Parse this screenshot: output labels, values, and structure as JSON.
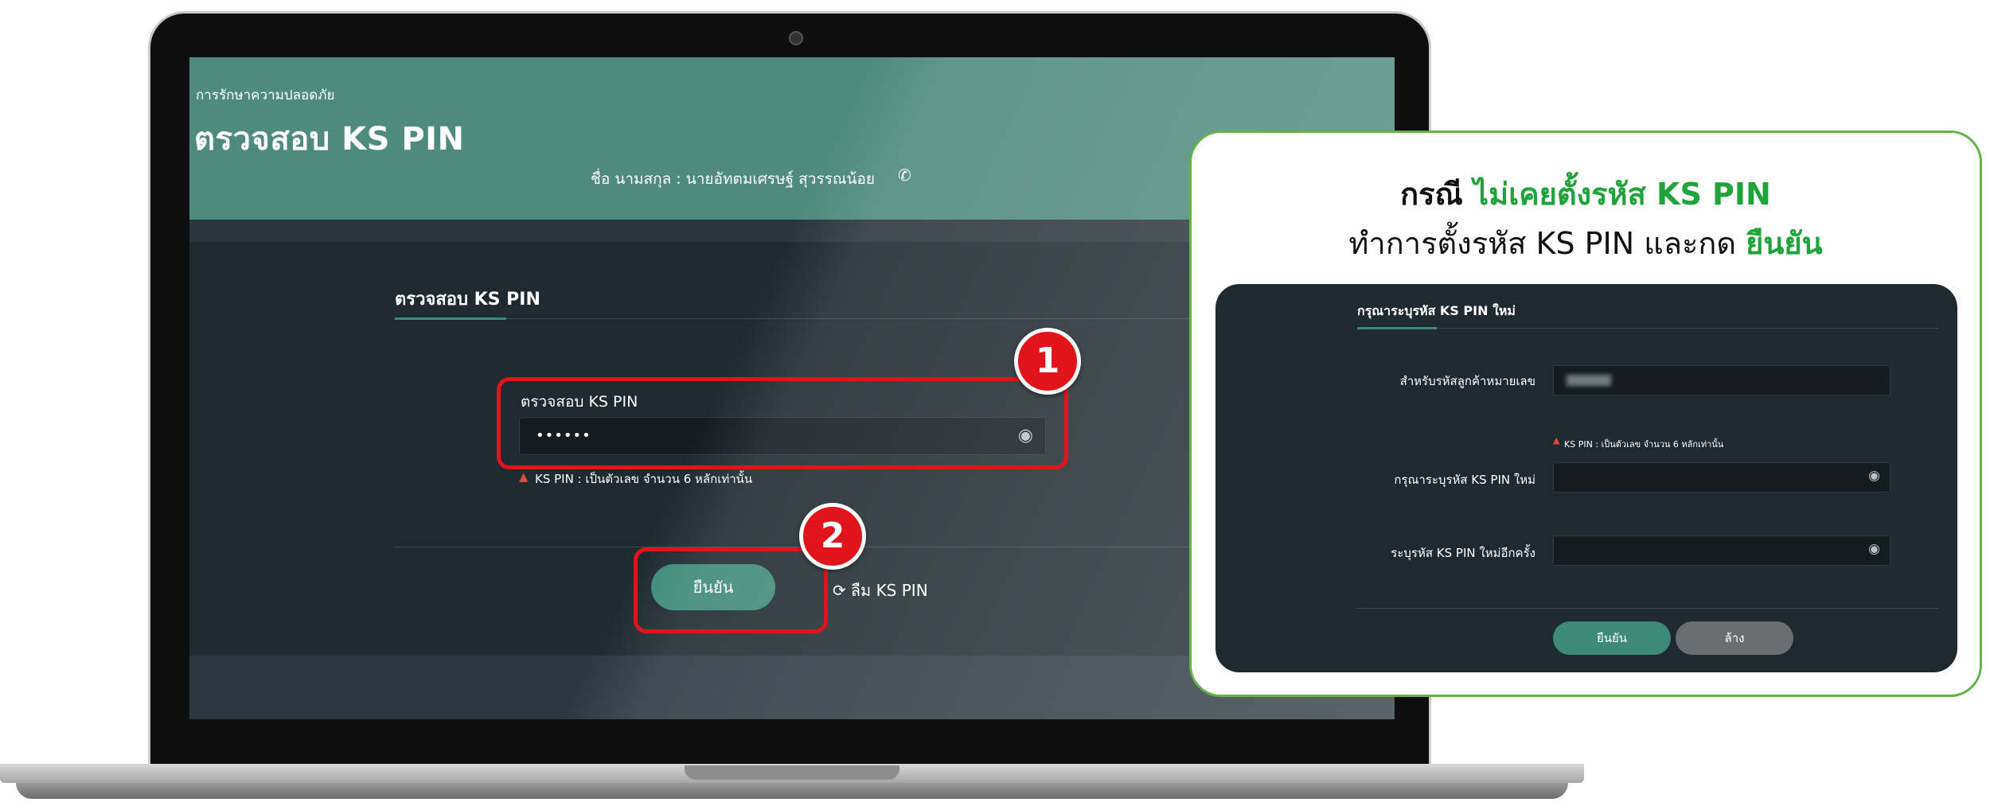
{
  "app": {
    "breadcrumb": "การรักษาความปลอดภัย",
    "page_title": "ตรวจสอบ KS PIN",
    "user_label": "ชื่อ นามสกุล :  นายอัทตมเศรษฐ์ สุวรรณน้อย"
  },
  "form": {
    "section_title": "ตรวจสอบ KS PIN",
    "field_label": "ตรวจสอบ KS PIN",
    "pin_value": "••••••",
    "hint": "KS PIN : เป็นตัวเลข จำนวน 6 หลักเท่านั้น",
    "confirm_label": "ยืนยัน",
    "forgot_label": "ลืม KS PIN"
  },
  "badges": {
    "step1": "1",
    "step2": "2"
  },
  "callout": {
    "line1_prefix": "กรณี ",
    "line1_highlight": "ไม่เคยตั้งรหัส KS PIN",
    "line2_prefix": "ทำการตั้งรหัส KS PIN และกด ",
    "line2_highlight": "ยืนยัน",
    "panel": {
      "title": "กรุณาระบุรหัส KS PIN ใหม่",
      "customer_label": "สำหรับรหัสลูกค้าหมายเลข",
      "hint": "KS PIN : เป็นตัวเลข จำนวน 6 หลักเท่านั้น",
      "new_pin_label": "กรุณาระบุรหัส KS PIN ใหม่",
      "confirm_pin_label": "ระบุรหัส KS PIN ใหม่อีกครั้ง",
      "confirm_label": "ยืนยัน",
      "clear_label": "ล้าง"
    }
  },
  "colors": {
    "header_teal": "#4e8a7d",
    "button_green": "#3d8a77",
    "highlight_red": "#e0141a",
    "callout_green": "#20a33a",
    "panel_dark": "#1e2a30"
  }
}
